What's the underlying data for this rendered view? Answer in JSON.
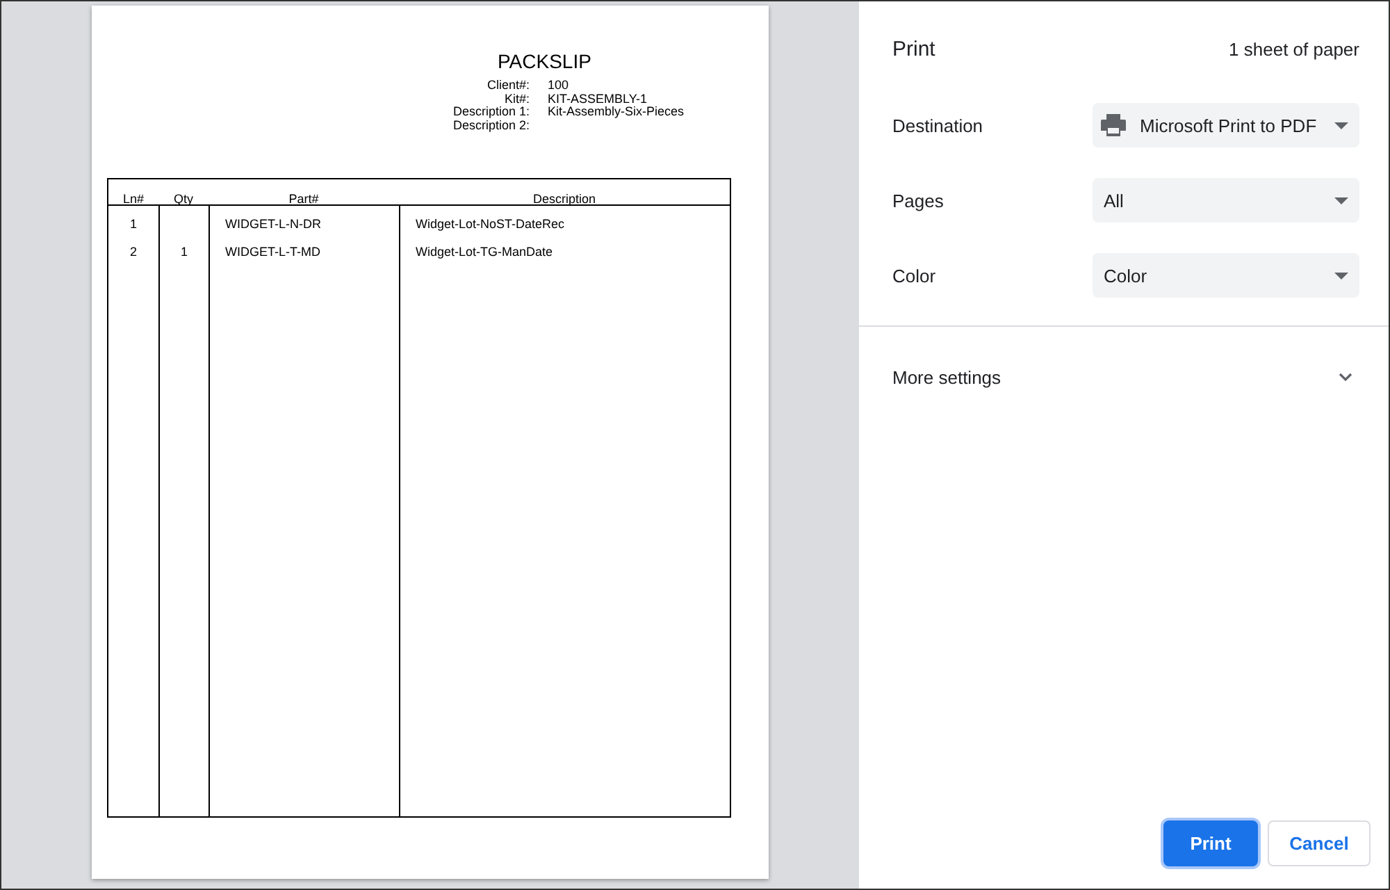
{
  "document": {
    "title": "PACKSLIP",
    "fields": [
      {
        "label": "Client#:",
        "value": "100"
      },
      {
        "label": "Kit#:",
        "value": "KIT-ASSEMBLY-1"
      },
      {
        "label": "Description 1:",
        "value": "Kit-Assembly-Six-Pieces"
      },
      {
        "label": "Description 2:"
      }
    ],
    "table": {
      "columns": [
        "Ln#",
        "Qty",
        "Part#",
        "Description"
      ],
      "rows": [
        {
          "ln": "1",
          "part": "WIDGET-L-N-DR",
          "description": "Widget-Lot-NoST-DateRec"
        },
        {
          "ln": "2",
          "qty": "1",
          "part": "WIDGET-L-T-MD",
          "description": "Widget-Lot-TG-ManDate"
        }
      ]
    }
  },
  "panel": {
    "title": "Print",
    "sheets": "1 sheet of paper",
    "settings": [
      {
        "label": "Destination",
        "value": "Microsoft Print to PDF",
        "kind": "printer"
      },
      {
        "label": "Pages",
        "value": "All",
        "kind": "plain"
      },
      {
        "label": "Color",
        "value": "Color",
        "kind": "plain"
      }
    ],
    "more_settings": {
      "label": "More settings",
      "expanded": false
    },
    "buttons": [
      {
        "label": "Print",
        "kind": "primary"
      },
      {
        "label": "Cancel",
        "kind": "secondary"
      }
    ]
  }
}
